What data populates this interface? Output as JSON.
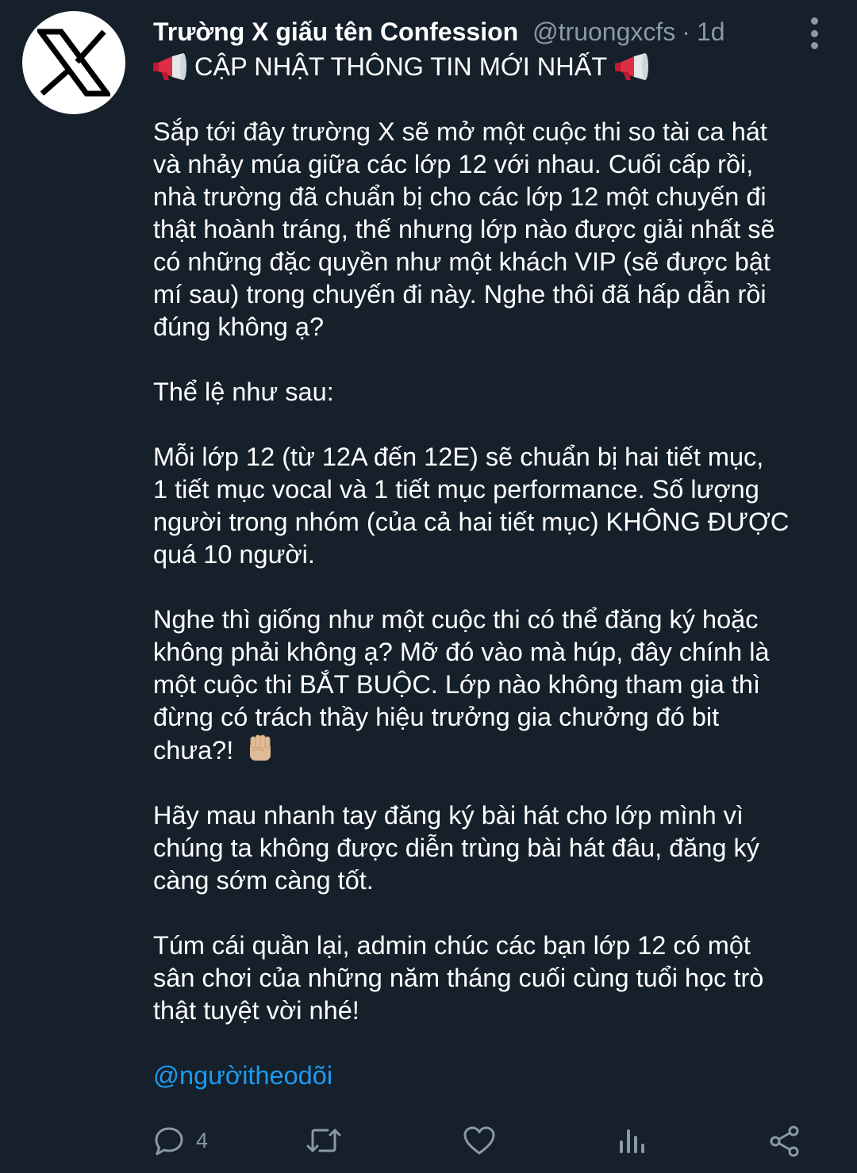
{
  "tweet": {
    "display_name": "Trường X giấu tên Confession",
    "handle": "@truongxcfs",
    "separator": "·",
    "time": "1d",
    "avatar_logo": "X",
    "headline": "CẬP NHẬT THÔNG TIN MỚI NHẤT",
    "paragraphs": [
      [
        "Sắp tới đây trường X sẽ mở một cuộc thi so tài ca hát",
        "và nhảy múa giữa các lớp 12 với nhau. Cuối cấp rồi,",
        "nhà trường đã chuẩn bị cho các lớp 12 một chuyến đi",
        "thật hoành tráng, thế nhưng lớp nào được giải nhất sẽ",
        "có những đặc quyền như một khách VIP (sẽ được bật",
        "mí sau) trong chuyến đi này. Nghe thôi đã hấp dẫn rồi",
        "đúng không ạ?"
      ],
      [
        "Thể lệ như sau:"
      ],
      [
        "Mỗi lớp 12 (từ 12A đến 12E) sẽ chuẩn bị hai tiết mục,",
        "1 tiết mục vocal và 1 tiết mục performance. Số lượng",
        "người trong nhóm (của cả hai tiết mục) KHÔNG ĐƯỢC",
        "quá 10 người."
      ],
      [
        "Nghe thì giống như một cuộc thi có thể đăng ký hoặc",
        "không phải không ạ? Mỡ đó vào mà húp, đây chính là",
        "một cuộc thi BẮT BUỘC. Lớp nào không tham gia thì",
        "đừng có trách thầy hiệu trưởng gia chưởng đó bit",
        "chưa?!"
      ],
      [
        "Hãy mau nhanh tay đăng ký bài hát cho lớp mình vì",
        "chúng ta không được diễn trùng bài hát đâu, đăng ký",
        "càng sớm càng tốt."
      ],
      [
        "Túm cái quần lại, admin chúc các bạn lớp 12 có một",
        "sân chơi của những năm tháng cuối cùng tuổi học trò",
        "thật tuyệt vời nhé!"
      ]
    ],
    "mention": "@ngườitheodõi",
    "reply_count": "4"
  },
  "colors": {
    "background": "#15202b",
    "text": "#ffffff",
    "muted": "#8b98a5",
    "link": "#1d9bf0"
  },
  "icons": {
    "avatar": "x-logo-icon",
    "more": "more-vertical-icon",
    "headline_emoji": "megaphone-icon",
    "fist_emoji": "raised-fist-icon",
    "reply": "reply-icon",
    "retweet": "retweet-icon",
    "like": "heart-icon",
    "views": "analytics-icon",
    "share": "share-icon"
  }
}
